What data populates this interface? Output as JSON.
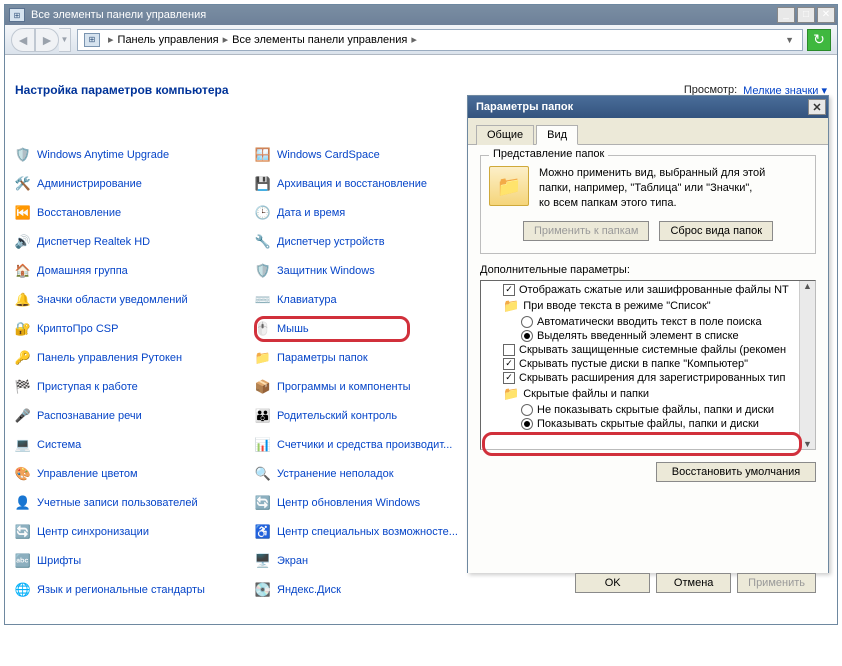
{
  "window": {
    "title": "Все элементы панели управления"
  },
  "breadcrumb": {
    "part1": "Панель управления",
    "part2": "Все элементы панели управления"
  },
  "page_title": "Настройка параметров компьютера",
  "view": {
    "label": "Просмотр:",
    "value": "Мелкие значки"
  },
  "items_col1": [
    "Windows Anytime Upgrade",
    "Администрирование",
    "Восстановление",
    "Диспетчер Realtek HD",
    "Домашняя группа",
    "Значки области уведомлений",
    "КриптоПро CSP",
    "Панель управления Рутокен",
    "Приступая к работе",
    "Распознавание речи",
    "Система",
    "Управление цветом",
    "Учетные записи пользователей",
    "Центр синхронизации",
    "Шрифты",
    "Язык и региональные стандарты"
  ],
  "items_col2": [
    "Windows CardSpace",
    "Архивация и восстановление",
    "Дата и время",
    "Диспетчер устройств",
    "Защитник Windows",
    "Клавиатура",
    "Мышь",
    "Параметры папок",
    "Программы и компоненты",
    "Родительский контроль",
    "Счетчики и средства производит...",
    "Устранение неполадок",
    "Центр обновления Windows",
    "Центр специальных возможносте...",
    "Экран",
    "Яндекс.Диск"
  ],
  "dialog": {
    "title": "Параметры папок",
    "tab_general": "Общие",
    "tab_view": "Вид",
    "group_legend": "Представление папок",
    "fv_text_l1": "Можно применить вид, выбранный для этой",
    "fv_text_l2": "папки, например, \"Таблица\" или \"Значки\",",
    "fv_text_l3": "ко всем папкам этого типа.",
    "apply_to_folders": "Применить к папкам",
    "reset_folders": "Сброс вида папок",
    "adv_label": "Дополнительные параметры:",
    "rows": {
      "r0": "Отображать сжатые или зашифрованные файлы NT",
      "r1": "При вводе текста в режиме \"Список\"",
      "r2": "Автоматически вводить текст в поле поиска",
      "r3": "Выделять введенный элемент в списке",
      "r4": "Скрывать защищенные системные файлы (рекомен",
      "r5": "Скрывать пустые диски в папке \"Компьютер\"",
      "r6": "Скрывать расширения для зарегистрированных тип",
      "r7": "Скрытые файлы и папки",
      "r8": "Не показывать скрытые файлы, папки и диски",
      "r9": "Показывать скрытые файлы, папки и диски"
    },
    "restore_defaults": "Восстановить умолчания",
    "ok": "OK",
    "cancel": "Отмена",
    "apply": "Применить"
  }
}
